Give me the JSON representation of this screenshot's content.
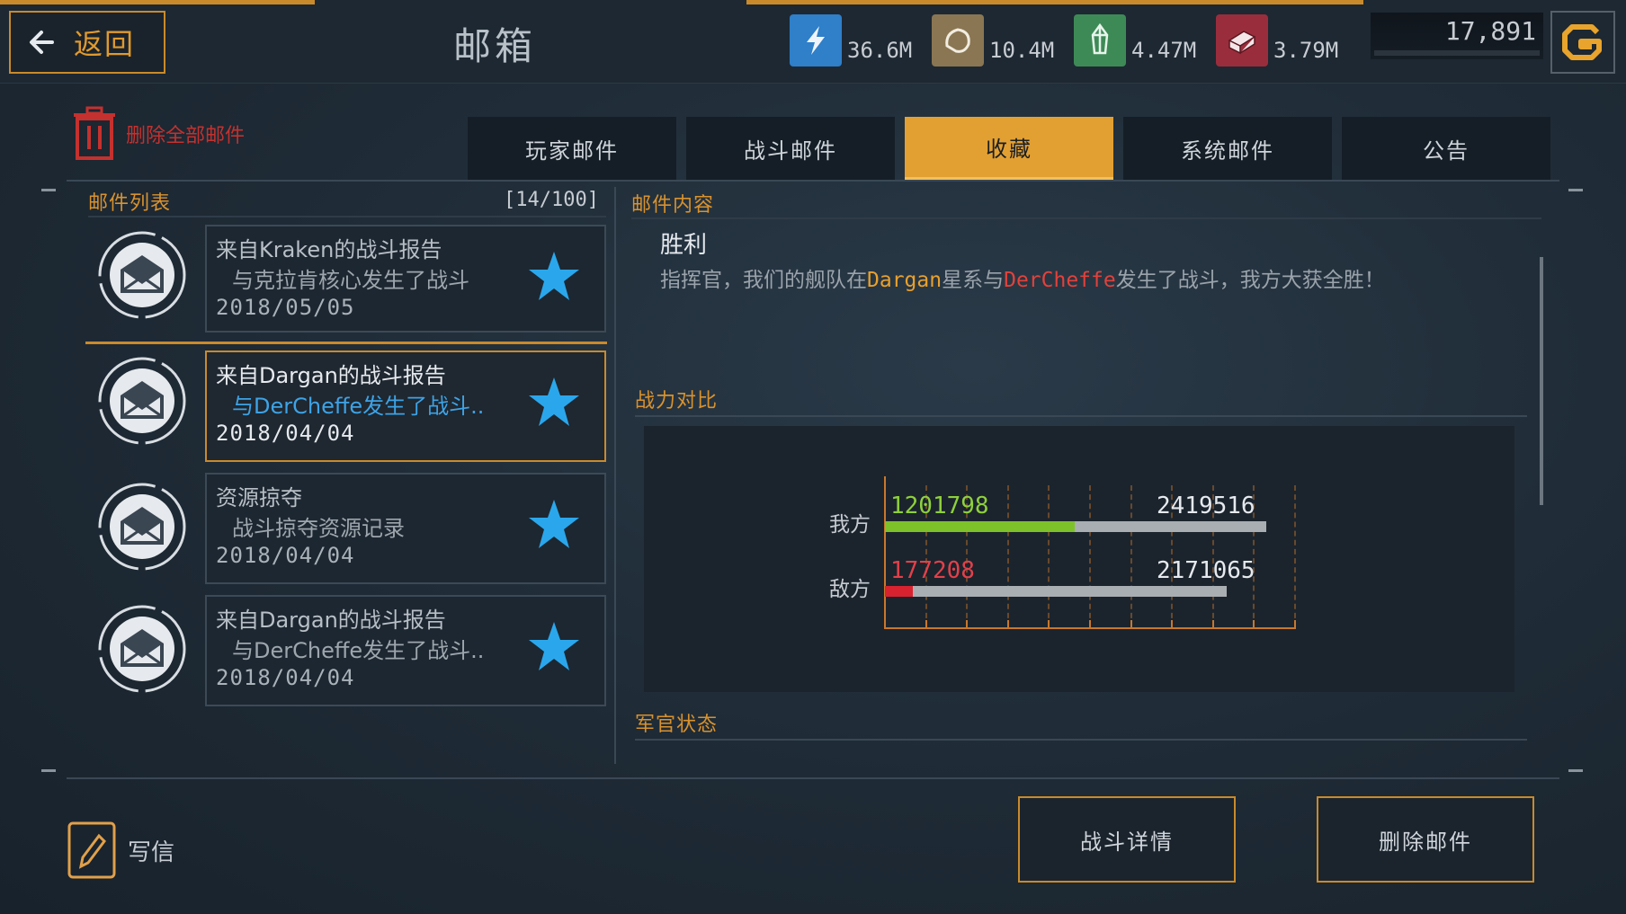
{
  "header": {
    "back_label": "返回",
    "title": "邮箱",
    "resources": [
      {
        "icon": "energy-icon",
        "value": "36.6M",
        "color": "#2f7fc9"
      },
      {
        "icon": "ore-icon",
        "value": "10.4M",
        "color": "#8a7652"
      },
      {
        "icon": "crystal-icon",
        "value": "4.47M",
        "color": "#3e8a56"
      },
      {
        "icon": "alloy-icon",
        "value": "3.79M",
        "color": "#9a2d3c"
      }
    ],
    "credits": "17,891"
  },
  "toolbar": {
    "delete_all_label": "删除全部邮件"
  },
  "tabs": [
    {
      "label": "玩家邮件",
      "active": false
    },
    {
      "label": "战斗邮件",
      "active": false
    },
    {
      "label": "收藏",
      "active": true
    },
    {
      "label": "系统邮件",
      "active": false
    },
    {
      "label": "公告",
      "active": false
    }
  ],
  "mail_list": {
    "title": "邮件列表",
    "count": "[14/100]",
    "items": [
      {
        "title": "来自Kraken的战斗报告",
        "subtitle": "与克拉肯核心发生了战斗",
        "date": "2018/05/05",
        "starred": true,
        "selected": false
      },
      {
        "title": "来自Dargan的战斗报告",
        "subtitle": "与DerCheffe发生了战斗..",
        "date": "2018/04/04",
        "starred": true,
        "selected": true
      },
      {
        "title": "资源掠夺",
        "subtitle": "战斗掠夺资源记录",
        "date": "2018/04/04",
        "starred": true,
        "selected": false
      },
      {
        "title": "来自Dargan的战斗报告",
        "subtitle": "与DerCheffe发生了战斗..",
        "date": "2018/04/04",
        "starred": true,
        "selected": false
      }
    ]
  },
  "mail_content": {
    "title": "邮件内容",
    "result": "胜利",
    "msg_part1": "指挥官，我们的舰队在",
    "msg_system": "Dargan",
    "msg_part2": "星系与",
    "msg_enemy": "DerCheffe",
    "msg_part3": "发生了战斗，我方大获全胜！",
    "power_title": "战力对比",
    "officer_title": "军官状态",
    "accent_color": "#e9a12e",
    "enemy_color": "#e3413b"
  },
  "power_compare": {
    "ours": {
      "label": "我方",
      "current": "1201798",
      "total": "2419516",
      "fraction": 0.497,
      "color": "#7ec22a"
    },
    "enemy": {
      "label": "敌方",
      "current": "177208",
      "total": "2171065",
      "fraction": 0.082,
      "color": "#d8222f"
    }
  },
  "footer": {
    "write_label": "写信",
    "battle_details_label": "战斗详情",
    "delete_mail_label": "删除邮件"
  }
}
